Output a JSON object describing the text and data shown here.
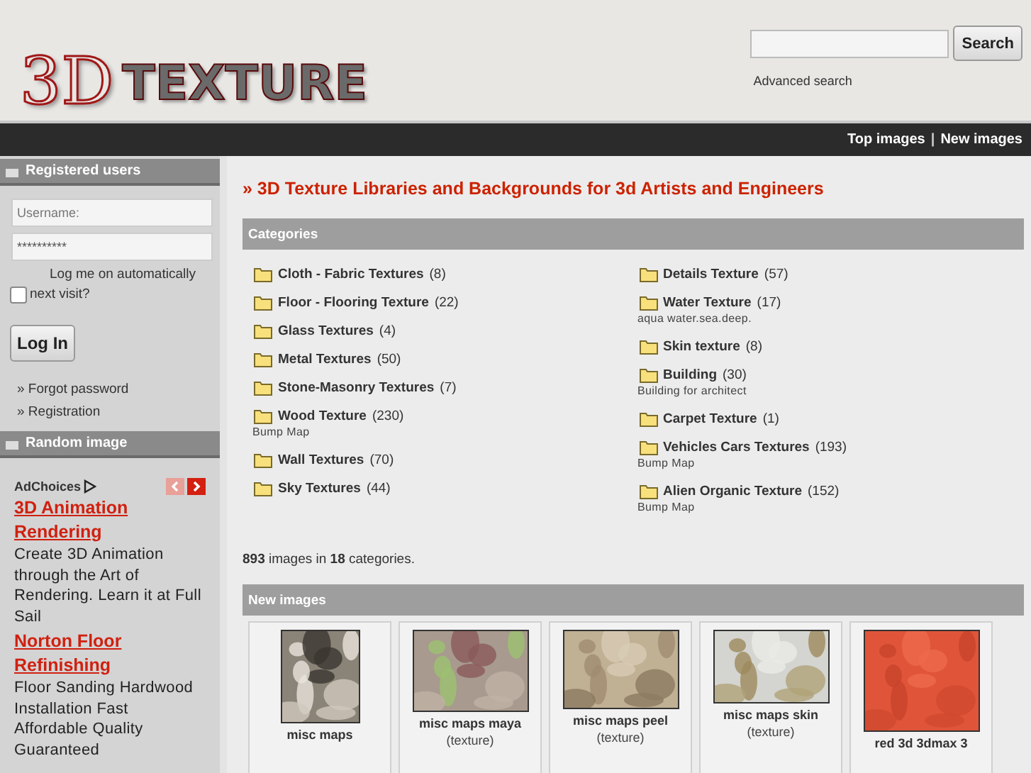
{
  "header": {
    "logo": {
      "prefix": "3D",
      "word": "TEXTURE"
    },
    "search": {
      "button": "Search",
      "link": "Advanced search"
    }
  },
  "top_nav": {
    "items": [
      "Top images",
      "New images"
    ],
    "separator": "|"
  },
  "sidebar": {
    "login": {
      "title": "Registered users",
      "username": {
        "placeholder": "Username:"
      },
      "password": {
        "value": "**********"
      },
      "remember": {
        "label": "Log me on automatically next visit?",
        "checked": false
      },
      "button": "Log In",
      "links": [
        "» Forgot password",
        "» Registration"
      ]
    },
    "random": {
      "title": "Random image",
      "adchoices": "AdChoices",
      "ads": [
        {
          "title": "3D Animation Rendering",
          "text": "Create 3D Animation through the Art of Rendering. Learn it at Full Sail"
        },
        {
          "title": "Norton Floor Refinishing",
          "text": "Floor Sanding Hardwood Installation Fast Affordable Quality Guaranteed"
        }
      ]
    }
  },
  "main": {
    "heading": "» 3D Texture Libraries and Backgrounds for 3d Artists and Engineers",
    "categories": {
      "title": "Categories",
      "columns": [
        [
          {
            "name": "Cloth - Fabric Textures",
            "count": "(8)"
          },
          {
            "name": "Floor - Flooring Texture",
            "count": "(22)"
          },
          {
            "name": "Glass Textures",
            "count": "(4)"
          },
          {
            "name": "Metal Textures",
            "count": "(50)"
          },
          {
            "name": "Stone-Masonry Textures",
            "count": "(7)"
          },
          {
            "name": "Wood Texture",
            "count": "(230)",
            "description": "Bump Map"
          },
          {
            "name": "Wall Textures",
            "count": "(70)"
          },
          {
            "name": "Sky Textures",
            "count": "(44)"
          }
        ],
        [
          {
            "name": "Details Texture",
            "count": "(57)"
          },
          {
            "name": "Water Texture",
            "count": "(17)",
            "description": "aqua water.sea.deep."
          },
          {
            "name": "Skin texture",
            "count": "(8)"
          },
          {
            "name": "Building",
            "count": "(30)",
            "description": "Building for architect"
          },
          {
            "name": "Carpet Texture",
            "count": "(1)"
          },
          {
            "name": "Vehicles Cars Textures",
            "count": "(193)",
            "description": "Bump Map"
          },
          {
            "name": "Alien Organic Texture",
            "count": "(152)",
            "description": "Bump Map"
          }
        ]
      ]
    },
    "stats": "**893** images in **18** categories.",
    "new_images": {
      "title": "New images",
      "items": [
        {
          "title": "misc maps",
          "kind": "picture"
        },
        {
          "title": "misc maps maya",
          "subtitle": "(texture)",
          "kind": "picture"
        },
        {
          "title": "misc maps peel",
          "subtitle": "(texture)",
          "kind": "picture"
        },
        {
          "title": "misc maps skin",
          "subtitle": "(texture)",
          "kind": "picture"
        },
        {
          "title": "red 3d 3dmax 3",
          "kind": "picture"
        }
      ]
    }
  }
}
